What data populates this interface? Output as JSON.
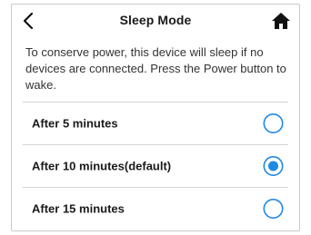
{
  "header": {
    "title": "Sleep Mode",
    "back_icon": "chevron-left-icon",
    "home_icon": "home-icon"
  },
  "description": "To conserve power, this device will sleep if no devices are connected. Press the Power button to wake.",
  "options": [
    {
      "label": "After 5 minutes",
      "selected": false
    },
    {
      "label": "After 10 minutes(default)",
      "selected": true
    },
    {
      "label": "After 15 minutes",
      "selected": false
    }
  ],
  "colors": {
    "accent": "#1e88e5",
    "divider": "#d4d4d4",
    "text": "#1a1a1a"
  }
}
